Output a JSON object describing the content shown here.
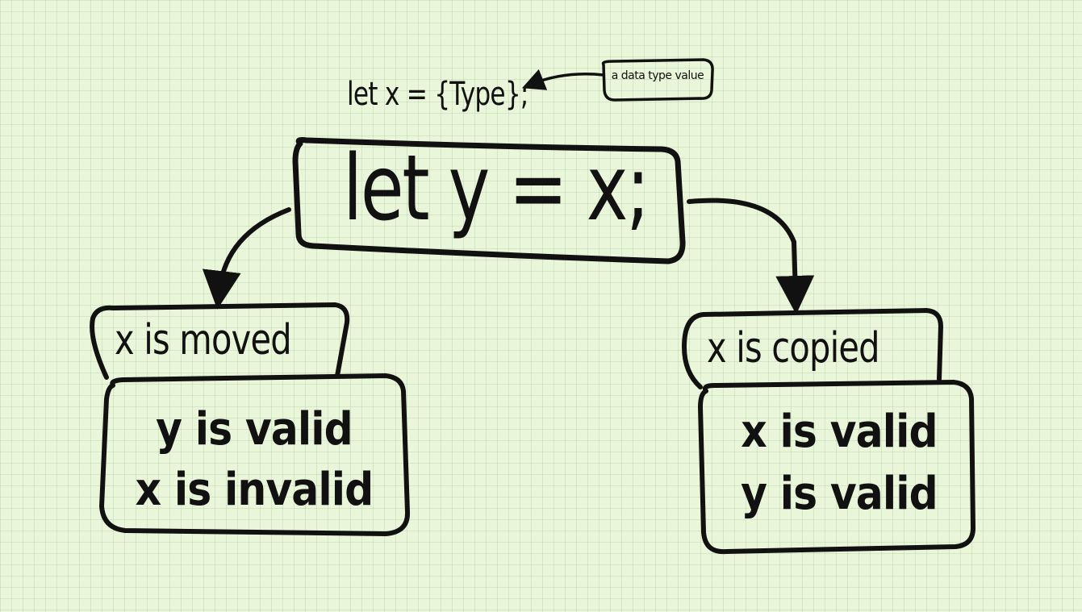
{
  "declaration": {
    "code": "let x =  {Type};"
  },
  "annotation": {
    "label": "a data type value"
  },
  "assignment": {
    "code": "let y = x;"
  },
  "moved_branch": {
    "label": "x is moved",
    "results": [
      "y is valid",
      "x is invalid"
    ]
  },
  "copied_branch": {
    "label": "x is copied",
    "results": [
      "x is valid",
      "y is valid"
    ]
  },
  "colors": {
    "background": "#eaf6da",
    "grid": "#a8cfa0",
    "ink": "#111111"
  }
}
